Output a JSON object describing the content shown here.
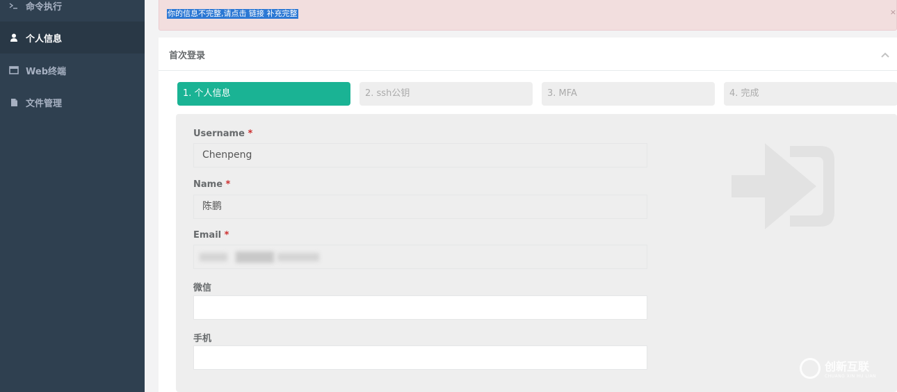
{
  "sidebar": {
    "items": [
      {
        "label": "命令执行",
        "icon": "terminal-icon"
      },
      {
        "label": "个人信息",
        "icon": "user-icon"
      },
      {
        "label": "Web终端",
        "icon": "window-icon"
      },
      {
        "label": "文件管理",
        "icon": "file-icon"
      }
    ]
  },
  "alert": {
    "text": "你的信息不完整,请点击 链接 补充完整",
    "close": "×"
  },
  "panel": {
    "title": "首次登录",
    "collapse_icon": "chevron-up-icon"
  },
  "steps": [
    {
      "label": "1. 个人信息",
      "active": true
    },
    {
      "label": "2. ssh公钥",
      "active": false
    },
    {
      "label": "3. MFA",
      "active": false
    },
    {
      "label": "4. 完成",
      "active": false
    }
  ],
  "form": {
    "username": {
      "label": "Username",
      "required": "*",
      "value": "Chenpeng"
    },
    "name": {
      "label": "Name",
      "required": "*",
      "value": "陈鹏"
    },
    "email": {
      "label": "Email",
      "required": "*",
      "value": ""
    },
    "wechat": {
      "label": "微信",
      "value": ""
    },
    "phone": {
      "label": "手机",
      "value": ""
    }
  },
  "decor": {
    "icon": "sign-in-icon"
  },
  "watermark": {
    "text": "创新互联",
    "subtext": "CHUANG XIN HU LIAN"
  },
  "colors": {
    "sidebar_bg": "#2f4050",
    "sidebar_active_bg": "#293846",
    "accent": "#1ab394",
    "alert_bg": "#f2dede",
    "required": "#cc2d2d"
  }
}
